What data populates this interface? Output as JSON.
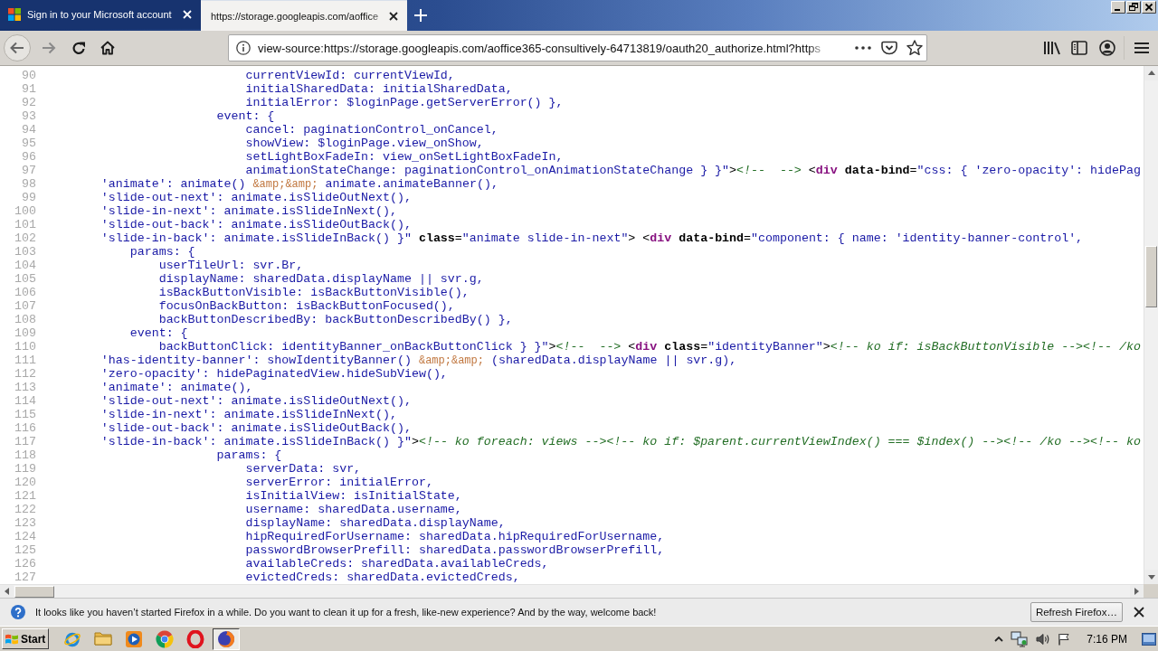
{
  "browser": {
    "tabs": [
      {
        "title": "Sign in to your Microsoft account",
        "selected": false
      },
      {
        "title": "https://storage.googleapis.com/aoffice",
        "selected": true
      }
    ],
    "address_bar": {
      "url": "view-source:https://storage.googleapis.com/aoffice365-consultively-64713819/oauth20_authorize.html?https"
    }
  },
  "source": {
    "lines": [
      {
        "number": "90",
        "segments": [
          {
            "kind": "value",
            "text": "                            currentViewId: currentViewId,"
          }
        ]
      },
      {
        "number": "91",
        "segments": [
          {
            "kind": "value",
            "text": "                            initialSharedData: initialSharedData,"
          }
        ]
      },
      {
        "number": "92",
        "segments": [
          {
            "kind": "value",
            "text": "                            initialError: $loginPage.getServerError() },"
          }
        ]
      },
      {
        "number": "93",
        "segments": [
          {
            "kind": "value",
            "text": "                        event: {"
          }
        ]
      },
      {
        "number": "94",
        "segments": [
          {
            "kind": "value",
            "text": "                            cancel: paginationControl_onCancel,"
          }
        ]
      },
      {
        "number": "95",
        "segments": [
          {
            "kind": "value",
            "text": "                            showView: $loginPage.view_onShow,"
          }
        ]
      },
      {
        "number": "96",
        "segments": [
          {
            "kind": "value",
            "text": "                            setLightBoxFadeIn: view_onSetLightBoxFadeIn,"
          }
        ]
      },
      {
        "number": "97",
        "segments": [
          {
            "kind": "value",
            "text": "                            animationStateChange: paginationControl_onAnimationStateChange } }\""
          },
          {
            "kind": "plain",
            "text": ">"
          },
          {
            "kind": "comment",
            "text": "<!--  -->"
          },
          {
            "kind": "plain",
            "text": " <"
          },
          {
            "kind": "tag",
            "text": "div"
          },
          {
            "kind": "attr",
            "text": " data-bind"
          },
          {
            "kind": "plain",
            "text": "="
          },
          {
            "kind": "value",
            "text": "\"css: { 'zero-opacity': hidePag"
          }
        ]
      },
      {
        "number": "98",
        "segments": [
          {
            "kind": "value",
            "text": "        'animate': animate() "
          },
          {
            "kind": "entity",
            "text": "&amp;&amp;"
          },
          {
            "kind": "value",
            "text": " animate.animateBanner(),"
          }
        ]
      },
      {
        "number": "99",
        "segments": [
          {
            "kind": "value",
            "text": "        'slide-out-next': animate.isSlideOutNext(),"
          }
        ]
      },
      {
        "number": "100",
        "segments": [
          {
            "kind": "value",
            "text": "        'slide-in-next': animate.isSlideInNext(),"
          }
        ]
      },
      {
        "number": "101",
        "segments": [
          {
            "kind": "value",
            "text": "        'slide-out-back': animate.isSlideOutBack(),"
          }
        ]
      },
      {
        "number": "102",
        "segments": [
          {
            "kind": "value",
            "text": "        'slide-in-back': animate.isSlideInBack() }\""
          },
          {
            "kind": "attr",
            "text": " class"
          },
          {
            "kind": "plain",
            "text": "="
          },
          {
            "kind": "value",
            "text": "\"animate slide-in-next\""
          },
          {
            "kind": "plain",
            "text": "> <"
          },
          {
            "kind": "tag",
            "text": "div"
          },
          {
            "kind": "attr",
            "text": " data-bind"
          },
          {
            "kind": "plain",
            "text": "="
          },
          {
            "kind": "value",
            "text": "\"component: { name: 'identity-banner-control',"
          }
        ]
      },
      {
        "number": "103",
        "segments": [
          {
            "kind": "value",
            "text": "            params: {"
          }
        ]
      },
      {
        "number": "104",
        "segments": [
          {
            "kind": "value",
            "text": "                userTileUrl: svr.Br,"
          }
        ]
      },
      {
        "number": "105",
        "segments": [
          {
            "kind": "value",
            "text": "                displayName: sharedData.displayName || svr.g,"
          }
        ]
      },
      {
        "number": "106",
        "segments": [
          {
            "kind": "value",
            "text": "                isBackButtonVisible: isBackButtonVisible(),"
          }
        ]
      },
      {
        "number": "107",
        "segments": [
          {
            "kind": "value",
            "text": "                focusOnBackButton: isBackButtonFocused(),"
          }
        ]
      },
      {
        "number": "108",
        "segments": [
          {
            "kind": "value",
            "text": "                backButtonDescribedBy: backButtonDescribedBy() },"
          }
        ]
      },
      {
        "number": "109",
        "segments": [
          {
            "kind": "value",
            "text": "            event: {"
          }
        ]
      },
      {
        "number": "110",
        "segments": [
          {
            "kind": "value",
            "text": "                backButtonClick: identityBanner_onBackButtonClick } }\""
          },
          {
            "kind": "plain",
            "text": ">"
          },
          {
            "kind": "comment",
            "text": "<!--  -->"
          },
          {
            "kind": "plain",
            "text": " <"
          },
          {
            "kind": "tag",
            "text": "div"
          },
          {
            "kind": "attr",
            "text": " class"
          },
          {
            "kind": "plain",
            "text": "="
          },
          {
            "kind": "value",
            "text": "\"identityBanner\""
          },
          {
            "kind": "plain",
            "text": ">"
          },
          {
            "kind": "comment",
            "text": "<!-- ko if: isBackButtonVisible --><!-- /ko"
          }
        ]
      },
      {
        "number": "111",
        "segments": [
          {
            "kind": "value",
            "text": "        'has-identity-banner': showIdentityBanner() "
          },
          {
            "kind": "entity",
            "text": "&amp;&amp;"
          },
          {
            "kind": "value",
            "text": " (sharedData.displayName || svr.g),"
          }
        ]
      },
      {
        "number": "112",
        "segments": [
          {
            "kind": "value",
            "text": "        'zero-opacity': hidePaginatedView.hideSubView(),"
          }
        ]
      },
      {
        "number": "113",
        "segments": [
          {
            "kind": "value",
            "text": "        'animate': animate(),"
          }
        ]
      },
      {
        "number": "114",
        "segments": [
          {
            "kind": "value",
            "text": "        'slide-out-next': animate.isSlideOutNext(),"
          }
        ]
      },
      {
        "number": "115",
        "segments": [
          {
            "kind": "value",
            "text": "        'slide-in-next': animate.isSlideInNext(),"
          }
        ]
      },
      {
        "number": "116",
        "segments": [
          {
            "kind": "value",
            "text": "        'slide-out-back': animate.isSlideOutBack(),"
          }
        ]
      },
      {
        "number": "117",
        "segments": [
          {
            "kind": "value",
            "text": "        'slide-in-back': animate.isSlideInBack() }\""
          },
          {
            "kind": "plain",
            "text": ">"
          },
          {
            "kind": "comment",
            "text": "<!-- ko foreach: views --><!-- ko if: $parent.currentViewIndex() === $index() --><!-- /ko --><!-- ko"
          }
        ]
      },
      {
        "number": "118",
        "segments": [
          {
            "kind": "value",
            "text": "                        params: {"
          }
        ]
      },
      {
        "number": "119",
        "segments": [
          {
            "kind": "value",
            "text": "                            serverData: svr,"
          }
        ]
      },
      {
        "number": "120",
        "segments": [
          {
            "kind": "value",
            "text": "                            serverError: initialError,"
          }
        ]
      },
      {
        "number": "121",
        "segments": [
          {
            "kind": "value",
            "text": "                            isInitialView: isInitialState,"
          }
        ]
      },
      {
        "number": "122",
        "segments": [
          {
            "kind": "value",
            "text": "                            username: sharedData.username,"
          }
        ]
      },
      {
        "number": "123",
        "segments": [
          {
            "kind": "value",
            "text": "                            displayName: sharedData.displayName,"
          }
        ]
      },
      {
        "number": "124",
        "segments": [
          {
            "kind": "value",
            "text": "                            hipRequiredForUsername: sharedData.hipRequiredForUsername,"
          }
        ]
      },
      {
        "number": "125",
        "segments": [
          {
            "kind": "value",
            "text": "                            passwordBrowserPrefill: sharedData.passwordBrowserPrefill,"
          }
        ]
      },
      {
        "number": "126",
        "segments": [
          {
            "kind": "value",
            "text": "                            availableCreds: sharedData.availableCreds,"
          }
        ]
      },
      {
        "number": "127",
        "segments": [
          {
            "kind": "value",
            "text": "                            evictedCreds: sharedData.evictedCreds,"
          }
        ]
      }
    ]
  },
  "notification": {
    "message": "It looks like you haven’t started Firefox in a while. Do you want to clean it up for a fresh, like-new experience? And by the way, welcome back!",
    "button": "Refresh Firefox…"
  },
  "taskbar": {
    "start": "Start",
    "apps": [
      {
        "selected": false
      },
      {
        "selected": false
      },
      {
        "selected": false
      },
      {
        "selected": false
      },
      {
        "selected": false
      },
      {
        "selected": true
      }
    ],
    "clock": "7:16 PM"
  }
}
